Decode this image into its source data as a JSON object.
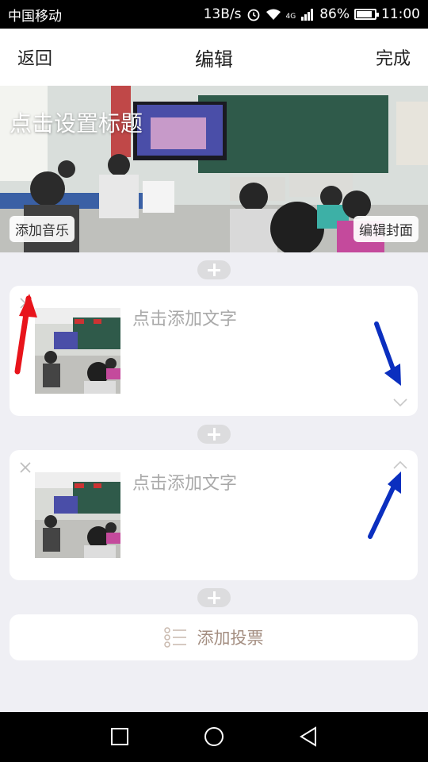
{
  "status": {
    "carrier": "中国移动",
    "speed": "13B/s",
    "network": "4G",
    "battery": "86%",
    "battery_level": 0.86,
    "time": "11:00"
  },
  "header": {
    "back": "返回",
    "title": "编辑",
    "done": "完成"
  },
  "cover": {
    "title": "点击设置标题",
    "add_music": "添加音乐",
    "edit_cover": "编辑封面"
  },
  "cards": [
    {
      "placeholder": "点击添加文字",
      "action_icon": "chevron-down-icon"
    },
    {
      "placeholder": "点击添加文字",
      "action_icon": "chevron-up-icon"
    }
  ],
  "vote": {
    "label": "添加投票",
    "icon": "list-icon"
  },
  "annotations": {
    "red": "#e8141b",
    "blue": "#0b2fbf"
  }
}
